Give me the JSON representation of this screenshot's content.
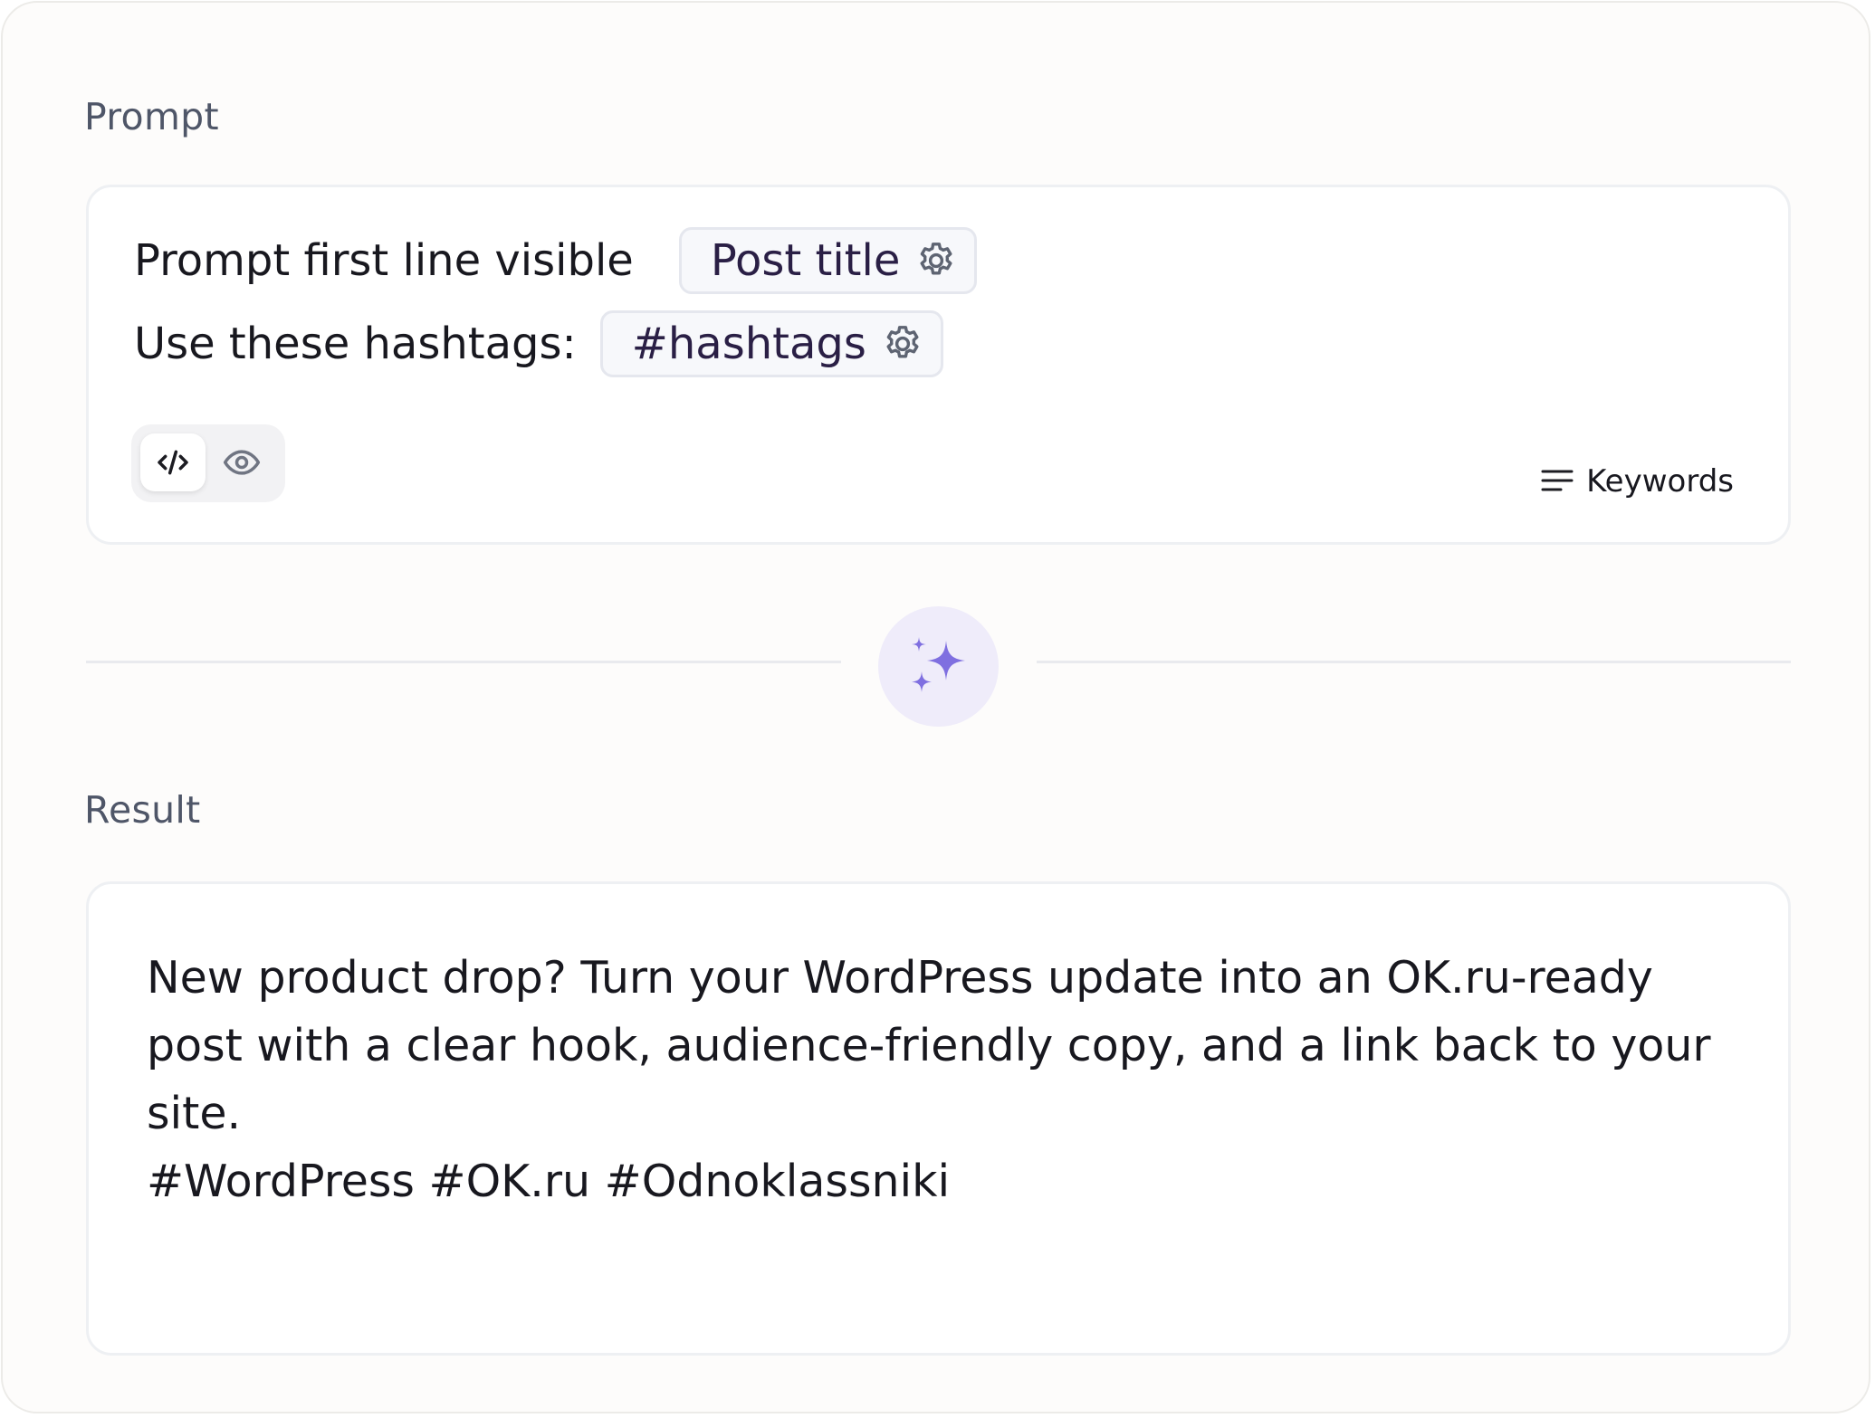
{
  "prompt": {
    "label": "Prompt",
    "line1_text": "Prompt first line visible",
    "line1_chip": "Post title",
    "line2_text": "Use these hashtags:",
    "line2_chip": "#hashtags",
    "view_toggle": {
      "code_icon": "code-icon",
      "preview_icon": "eye-icon",
      "active": "code"
    },
    "keywords_icon": "lines-icon",
    "keywords_label": "Keywords"
  },
  "generate": {
    "icon": "sparkles-icon",
    "accent_color": "#7f6fe0",
    "background_color": "#efecfa"
  },
  "result": {
    "label": "Result",
    "body": "New product drop? Turn your WordPress update into an OK.ru-ready post with a clear hook, audience-friendly copy, and a link back to your site.",
    "hashtags": "#WordPress #OK.ru #Odnoklassniki"
  }
}
